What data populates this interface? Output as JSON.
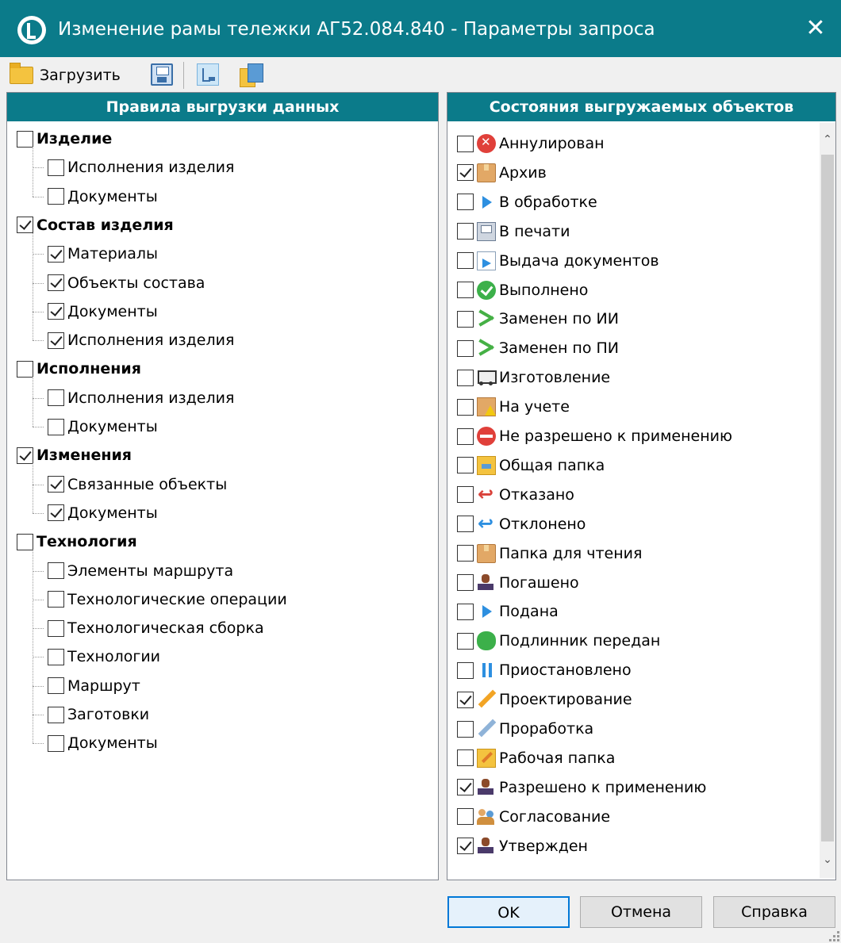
{
  "window": {
    "title": "Изменение рамы тележки АГ52.084.840 - Параметры запроса",
    "accent_color": "#0b7b8a"
  },
  "toolbar": {
    "load_label": "Загрузить"
  },
  "left_panel": {
    "header": "Правила выгрузки данных",
    "items": [
      {
        "label": "Изделие",
        "level": 0,
        "checked": false
      },
      {
        "label": "Исполнения изделия",
        "level": 1,
        "checked": false
      },
      {
        "label": "Документы",
        "level": 1,
        "checked": false
      },
      {
        "label": "Состав изделия",
        "level": 0,
        "checked": true
      },
      {
        "label": "Материалы",
        "level": 1,
        "checked": true
      },
      {
        "label": "Объекты состава",
        "level": 1,
        "checked": true
      },
      {
        "label": "Документы",
        "level": 1,
        "checked": true
      },
      {
        "label": "Исполнения изделия",
        "level": 1,
        "checked": true
      },
      {
        "label": "Исполнения",
        "level": 0,
        "checked": false
      },
      {
        "label": "Исполнения изделия",
        "level": 1,
        "checked": false
      },
      {
        "label": "Документы",
        "level": 1,
        "checked": false
      },
      {
        "label": "Изменения",
        "level": 0,
        "checked": true
      },
      {
        "label": "Связанные объекты",
        "level": 1,
        "checked": true
      },
      {
        "label": "Документы",
        "level": 1,
        "checked": true
      },
      {
        "label": "Технология",
        "level": 0,
        "checked": false
      },
      {
        "label": "Элементы маршрута",
        "level": 1,
        "checked": false
      },
      {
        "label": "Технологические операции",
        "level": 1,
        "checked": false
      },
      {
        "label": "Технологическая сборка",
        "level": 1,
        "checked": false
      },
      {
        "label": "Технологии",
        "level": 1,
        "checked": false
      },
      {
        "label": "Маршрут",
        "level": 1,
        "checked": false
      },
      {
        "label": "Заготовки",
        "level": 1,
        "checked": false
      },
      {
        "label": "Документы",
        "level": 1,
        "checked": false
      }
    ]
  },
  "right_panel": {
    "header": "Состояния выгружаемых объектов",
    "items": [
      {
        "label": "Аннулирован",
        "icon": "cancelled-icon",
        "checked": false
      },
      {
        "label": "Архив",
        "icon": "archive-box-icon",
        "checked": true
      },
      {
        "label": "В обработке",
        "icon": "play-icon",
        "checked": false
      },
      {
        "label": "В печати",
        "icon": "printer-icon",
        "checked": false
      },
      {
        "label": "Выдача документов",
        "icon": "document-issue-icon",
        "checked": false
      },
      {
        "label": "Выполнено",
        "icon": "done-check-icon",
        "checked": false
      },
      {
        "label": "Заменен по ИИ",
        "icon": "shuffle-icon",
        "checked": false
      },
      {
        "label": "Заменен по ПИ",
        "icon": "shuffle-icon",
        "checked": false
      },
      {
        "label": "Изготовление",
        "icon": "truck-icon",
        "checked": false
      },
      {
        "label": "На учете",
        "icon": "warning-box-icon",
        "checked": false
      },
      {
        "label": "Не разрешено к применению",
        "icon": "no-entry-icon",
        "checked": false
      },
      {
        "label": "Общая папка",
        "icon": "shared-folder-icon",
        "checked": false
      },
      {
        "label": "Отказано",
        "icon": "return-red-icon",
        "checked": false
      },
      {
        "label": "Отклонено",
        "icon": "return-blue-icon",
        "checked": false
      },
      {
        "label": "Папка для чтения",
        "icon": "archive-box-icon",
        "checked": false
      },
      {
        "label": "Погашено",
        "icon": "stamp-icon",
        "checked": false
      },
      {
        "label": "Подана",
        "icon": "play-icon",
        "checked": false
      },
      {
        "label": "Подлинник передан",
        "icon": "transfer-icon",
        "checked": false
      },
      {
        "label": "Приостановлено",
        "icon": "pause-icon",
        "checked": false
      },
      {
        "label": "Проектирование",
        "icon": "pencil-icon",
        "checked": true
      },
      {
        "label": "Проработка",
        "icon": "pencil-blue-icon",
        "checked": false
      },
      {
        "label": "Рабочая папка",
        "icon": "work-folder-icon",
        "checked": false
      },
      {
        "label": "Разрешено к применению",
        "icon": "stamp-icon",
        "checked": true
      },
      {
        "label": "Согласование",
        "icon": "people-icon",
        "checked": false
      },
      {
        "label": "Утвержден",
        "icon": "stamp-icon",
        "checked": true
      }
    ]
  },
  "buttons": {
    "ok": "OK",
    "cancel": "Отмена",
    "help": "Справка"
  }
}
